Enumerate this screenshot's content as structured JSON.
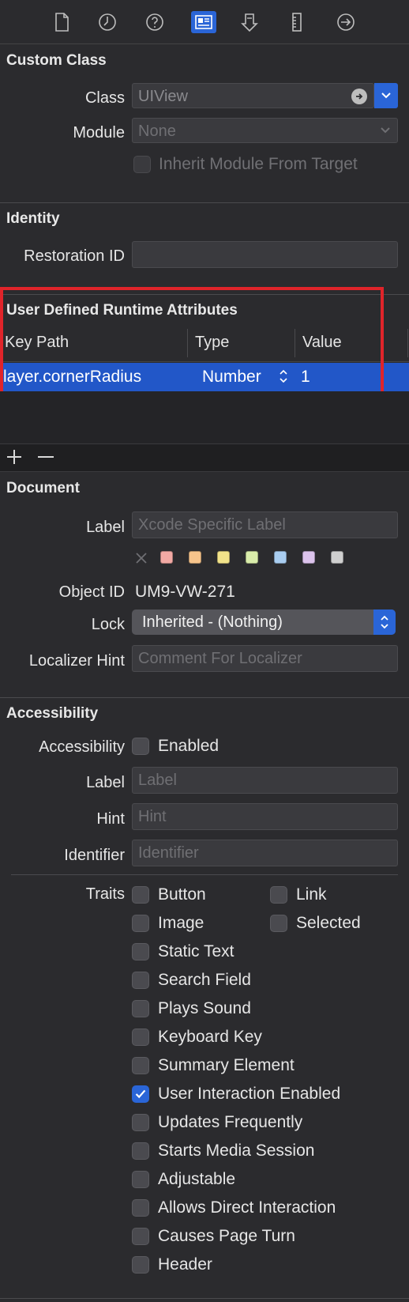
{
  "toolbar": {
    "icons": [
      "file-icon",
      "history-icon",
      "help-icon",
      "identity-inspector-icon",
      "attributes-inspector-icon",
      "size-inspector-icon",
      "connections-icon"
    ],
    "active_index": 3
  },
  "custom_class": {
    "title": "Custom Class",
    "class_label": "Class",
    "class_value": "UIView",
    "module_label": "Module",
    "module_value": "None",
    "inherit_label": "Inherit Module From Target"
  },
  "identity": {
    "title": "Identity",
    "restoration_label": "Restoration ID",
    "restoration_value": ""
  },
  "runtime_attributes": {
    "title": "User Defined Runtime Attributes",
    "columns": [
      "Key Path",
      "Type",
      "Value"
    ],
    "rows": [
      {
        "key_path": "layer.cornerRadius",
        "type": "Number",
        "value": "1"
      }
    ]
  },
  "controls": {
    "add": "+",
    "remove": "—"
  },
  "document": {
    "title": "Document",
    "label_label": "Label",
    "label_placeholder": "Xcode Specific Label",
    "swatch_colors": [
      "#f2a9a4",
      "#f7c48b",
      "#f2e38a",
      "#d9ecaa",
      "#a9cdf0",
      "#dcc3ec",
      "#cfcfcf"
    ],
    "object_id_label": "Object ID",
    "object_id_value": "UM9-VW-271",
    "lock_label": "Lock",
    "lock_value": "Inherited - (Nothing)",
    "localizer_label": "Localizer Hint",
    "localizer_placeholder": "Comment For Localizer"
  },
  "accessibility": {
    "title": "Accessibility",
    "accessibility_label": "Accessibility",
    "enabled_label": "Enabled",
    "label_label": "Label",
    "label_placeholder": "Label",
    "hint_label": "Hint",
    "hint_placeholder": "Hint",
    "identifier_label": "Identifier",
    "identifier_placeholder": "Identifier",
    "traits_label": "Traits",
    "traits": [
      {
        "label": "Button",
        "checked": false
      },
      {
        "label": "Link",
        "checked": false
      },
      {
        "label": "Image",
        "checked": false
      },
      {
        "label": "Selected",
        "checked": false
      },
      {
        "label": "Static Text",
        "checked": false
      },
      {
        "label": "Search Field",
        "checked": false
      },
      {
        "label": "Plays Sound",
        "checked": false
      },
      {
        "label": "Keyboard Key",
        "checked": false
      },
      {
        "label": "Summary Element",
        "checked": false
      },
      {
        "label": "User Interaction Enabled",
        "checked": true
      },
      {
        "label": "Updates Frequently",
        "checked": false
      },
      {
        "label": "Starts Media Session",
        "checked": false
      },
      {
        "label": "Adjustable",
        "checked": false
      },
      {
        "label": "Allows Direct Interaction",
        "checked": false
      },
      {
        "label": "Causes Page Turn",
        "checked": false
      },
      {
        "label": "Header",
        "checked": false
      }
    ]
  },
  "colors": {
    "accent": "#2a65d7",
    "highlight": "#e0242a",
    "selection": "#2257c8"
  }
}
